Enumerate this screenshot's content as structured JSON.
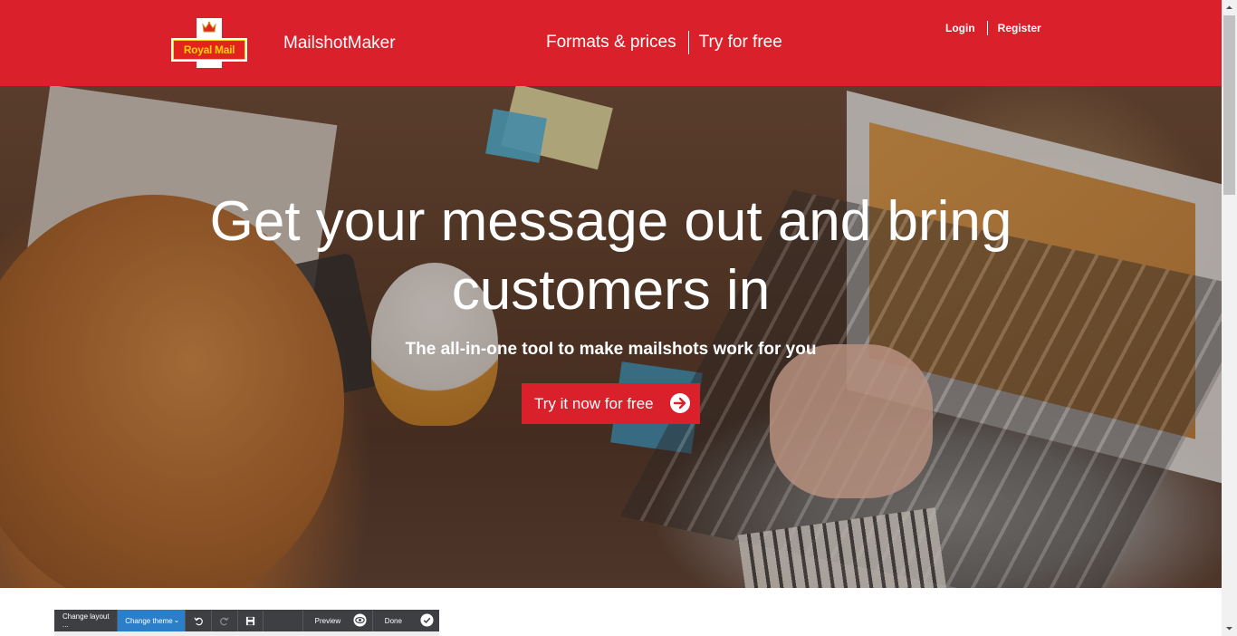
{
  "header": {
    "logo_text": "Royal Mail",
    "brand_part1": "Mailshot",
    "brand_part2": "Maker",
    "nav": [
      "Formats & prices",
      "Try for free"
    ],
    "login": "Login",
    "register": "Register",
    "brand_color": "#da202a"
  },
  "hero": {
    "title_line1": "Get your message out and bring",
    "title_line2": "customers in",
    "subtitle": "The all-in-one tool to make mailshots work for you",
    "cta_label": "Try it now for free",
    "cta_icon": "arrow-right-circle-icon"
  },
  "editor_toolbar": {
    "change_layout": "Change layout ...",
    "change_theme": "Change theme",
    "preview": "Preview",
    "done": "Done",
    "icons": [
      "undo-icon",
      "redo-icon",
      "save-icon",
      "eye-icon",
      "check-circle-icon"
    ],
    "active_color": "#2a7fc8"
  }
}
